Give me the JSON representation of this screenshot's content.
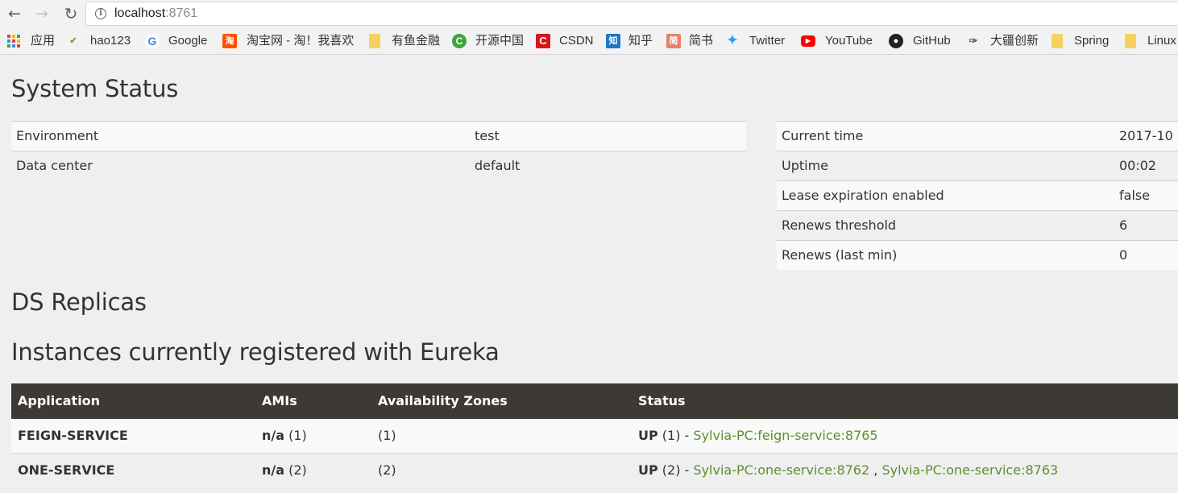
{
  "browser": {
    "url_host": "localhost",
    "url_port": ":8761"
  },
  "bookmarks": [
    {
      "label": "应用",
      "icon": "apps-grid-icon",
      "color": ""
    },
    {
      "label": "hao123",
      "icon": "hao123-icon",
      "color": "#6aaa2e"
    },
    {
      "label": "Google",
      "icon": "google-icon",
      "color": "#4285f4"
    },
    {
      "label": "淘宝网 - 淘！我喜欢",
      "icon": "taobao-icon",
      "color": "#ff5000"
    },
    {
      "label": "有鱼金融",
      "icon": "folder-icon",
      "color": "#f5d25e"
    },
    {
      "label": "开源中国",
      "icon": "oschina-icon",
      "color": "#3ca43a"
    },
    {
      "label": "CSDN",
      "icon": "csdn-icon",
      "color": "#d6171c"
    },
    {
      "label": "知乎",
      "icon": "zhihu-icon",
      "color": "#1e74c7"
    },
    {
      "label": "简书",
      "icon": "jianshu-icon",
      "color": "#e9806b"
    },
    {
      "label": "Twitter",
      "icon": "twitter-icon",
      "color": "#1da1f2"
    },
    {
      "label": "YouTube",
      "icon": "youtube-icon",
      "color": "#ff0000"
    },
    {
      "label": "GitHub",
      "icon": "github-icon",
      "color": "#222222"
    },
    {
      "label": "大疆创新",
      "icon": "dji-icon",
      "color": "#555555"
    },
    {
      "label": "Spring",
      "icon": "folder-icon",
      "color": "#f5d25e"
    },
    {
      "label": "Linux",
      "icon": "folder-icon",
      "color": "#f5d25e"
    }
  ],
  "system_status": {
    "title": "System Status",
    "left": [
      {
        "label": "Environment",
        "value": "test"
      },
      {
        "label": "Data center",
        "value": "default"
      }
    ],
    "right": [
      {
        "label": "Current time",
        "value": "2017-10"
      },
      {
        "label": "Uptime",
        "value": "00:02"
      },
      {
        "label": "Lease expiration enabled",
        "value": "false"
      },
      {
        "label": "Renews threshold",
        "value": "6"
      },
      {
        "label": "Renews (last min)",
        "value": "0"
      }
    ]
  },
  "ds_replicas": {
    "title": "DS Replicas"
  },
  "instances": {
    "title": "Instances currently registered with Eureka",
    "headers": [
      "Application",
      "AMIs",
      "Availability Zones",
      "Status"
    ],
    "rows": [
      {
        "application": "FEIGN-SERVICE",
        "ami_bold": "n/a",
        "ami_count": " (1)",
        "zones": "(1)",
        "status_bold": "UP",
        "status_count": " (1) - ",
        "links": [
          "Sylvia-PC:feign-service:8765"
        ]
      },
      {
        "application": "ONE-SERVICE",
        "ami_bold": "n/a",
        "ami_count": " (2)",
        "zones": "(2)",
        "status_bold": "UP",
        "status_count": " (2) - ",
        "links": [
          "Sylvia-PC:one-service:8762",
          "Sylvia-PC:one-service:8763"
        ],
        "separator": " , "
      }
    ]
  }
}
